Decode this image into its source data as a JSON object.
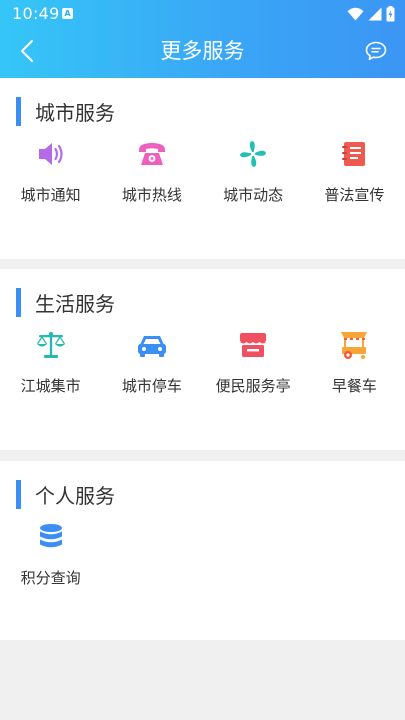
{
  "status_bar": {
    "time": "10:49",
    "app_badge": "A"
  },
  "header": {
    "title": "更多服务"
  },
  "sections": [
    {
      "title": "城市服务",
      "items": [
        {
          "label": "城市通知",
          "icon": "speaker-icon",
          "color": "#b56be8"
        },
        {
          "label": "城市热线",
          "icon": "telephone-icon",
          "color": "#ef5fbf"
        },
        {
          "label": "城市动态",
          "icon": "pinwheel-icon",
          "color": "#22bfb5"
        },
        {
          "label": "普法宣传",
          "icon": "notebook-icon",
          "color": "#ee5a4f"
        }
      ]
    },
    {
      "title": "生活服务",
      "items": [
        {
          "label": "江城集市",
          "icon": "balance-scale-icon",
          "color": "#27b8b0"
        },
        {
          "label": "城市停车",
          "icon": "car-icon",
          "color": "#3b8ff3"
        },
        {
          "label": "便民服务亭",
          "icon": "kiosk-icon",
          "color": "#ef5160"
        },
        {
          "label": "早餐车",
          "icon": "food-cart-icon",
          "color": "#f7a635"
        }
      ]
    },
    {
      "title": "个人服务",
      "items": [
        {
          "label": "积分查询",
          "icon": "database-icon",
          "color": "#3b8ff3"
        }
      ]
    }
  ]
}
